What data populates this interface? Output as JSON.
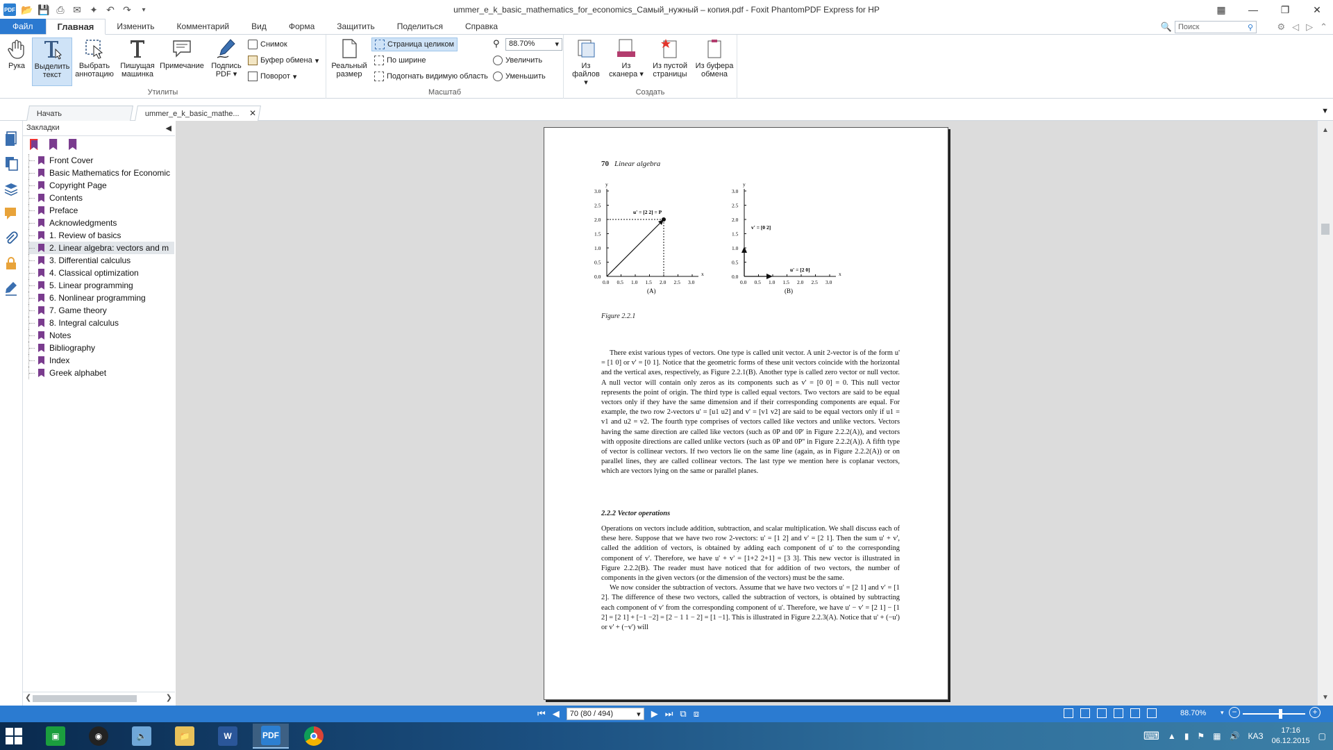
{
  "titlebar": {
    "app_icon_label": "PDF",
    "title": "ummer_e_k_basic_mathematics_for_economics_Самый_нужный – копия.pdf - Foxit PhantomPDF Express for HP"
  },
  "ribbon_tabs": [
    "Файл",
    "Главная",
    "Изменить",
    "Комментарий",
    "Вид",
    "Форма",
    "Защитить",
    "Поделиться",
    "Справка"
  ],
  "search": {
    "placeholder": "Поиск"
  },
  "ribbon": {
    "utilities": {
      "label": "Утилиты",
      "hand": "Рука",
      "select_text_1": "Выделить",
      "select_text_2": "текст",
      "select_annot_1": "Выбрать",
      "select_annot_2": "аннотацию",
      "typewriter_1": "Пишущая",
      "typewriter_2": "машинка",
      "note": "Примечание",
      "sign_1": "Подпись",
      "sign_2": "PDF",
      "snapshot": "Снимок",
      "clipboard": "Буфер обмена",
      "rotate": "Поворот"
    },
    "zoom": {
      "label": "Масштаб",
      "actual_1": "Реальный",
      "actual_2": "размер",
      "fit_page": "Страница целиком",
      "fit_width": "По ширине",
      "fit_visible": "Подогнать видимую область",
      "value": "88.70%",
      "zoom_in": "Увеличить",
      "zoom_out": "Уменьшить"
    },
    "create": {
      "label": "Создать",
      "from_files_1": "Из",
      "from_files_2": "файлов",
      "from_scanner_1": "Из",
      "from_scanner_2": "сканера",
      "from_blank_1": "Из пустой",
      "from_blank_2": "страницы",
      "from_clip_1": "Из буфера",
      "from_clip_2": "обмена"
    }
  },
  "doctabs": {
    "start": "Начать",
    "current": "ummer_e_k_basic_mathe..."
  },
  "bookmarks": {
    "title": "Закладки",
    "items": [
      "Front Cover",
      "Basic Mathematics for Economic",
      "Copyright Page",
      "Contents",
      "Preface",
      "Acknowledgments",
      "1. Review of basics",
      "2. Linear algebra: vectors and m",
      "3. Differential calculus",
      "4. Classical optimization",
      "5. Linear programming",
      "6. Nonlinear programming",
      "7. Game theory",
      "8. Integral calculus",
      "Notes",
      "Bibliography",
      "Index",
      "Greek alphabet"
    ],
    "selected_index": 7
  },
  "page": {
    "number": "70",
    "running_title": "Linear algebra",
    "figure_caption": "Figure 2.2.1",
    "figA": {
      "label": "(A)",
      "annotation": "u' = [2  2] = P",
      "x_ticks": [
        "0.0",
        "0.5",
        "1.0",
        "1.5",
        "2.0",
        "2.5",
        "3.0"
      ],
      "y_ticks": [
        "0.0",
        "0.5",
        "1.0",
        "1.5",
        "2.0",
        "2.5",
        "3.0"
      ],
      "x_axis": "x",
      "y_axis": "y"
    },
    "figB": {
      "label": "(B)",
      "annotation_v": "v' = [0  2]",
      "annotation_u": "u' = [2  0]",
      "x_ticks": [
        "0.0",
        "0.5",
        "1.0",
        "1.5",
        "2.0",
        "2.5",
        "3.0"
      ],
      "y_ticks": [
        "0.0",
        "0.5",
        "1.0",
        "1.5",
        "2.0",
        "2.5",
        "3.0"
      ],
      "x_axis": "x",
      "y_axis": "y"
    },
    "para1": "There exist various types of vectors. One type is called unit vector. A unit 2-vector is of the form u' = [1  0] or v' = [0  1]. Notice that the geometric forms of these unit vectors coincide with the horizontal and the vertical axes, respectively, as Figure 2.2.1(B). Another type is called zero vector or null vector. A null vector will contain only zeros as its components such as v' = [0  0] = 0. This null vector represents the point of origin. The third type is called equal vectors. Two vectors are said to be equal vectors only if they have the same dimension and if their corresponding components are equal. For example, the two row 2-vectors u' = [u1  u2] and v' = [v1  v2] are said to be equal vectors only if u1 = v1 and u2 = v2. The fourth type comprises of vectors called like vectors and unlike vectors. Vectors having the same direction are called like vectors (such as 0P and 0P' in Figure 2.2.2(A)), and vectors with opposite directions are called unlike vectors (such as 0P and 0P'' in Figure 2.2.2(A)). A fifth type of vector is collinear vectors. If two vectors lie on the same line (again, as in Figure 2.2.2(A)) or on parallel lines, they are called collinear vectors. The last type we mention here is coplanar vectors, which are vectors lying on the same or parallel planes.",
    "subheading": "2.2.2  Vector operations",
    "para2": "Operations on vectors include addition, subtraction, and scalar multiplication. We shall discuss each of these here. Suppose that we have two row 2-vectors: u' = [1  2] and v' = [2  1]. Then the sum u' + v', called the addition of vectors, is obtained by adding each component of u' to the corresponding component of v'. Therefore, we have u' + v' = [1+2  2+1] = [3  3]. This new vector is illustrated in Figure 2.2.2(B). The reader must have noticed that for addition of two vectors, the number of components in the given vectors (or the dimension of the vectors) must be the same.",
    "para3": "We now consider the subtraction of vectors. Assume that we have two vectors u' = [2  1] and v' = [1  2]. The difference of these two vectors, called the subtraction of vectors, is obtained by subtracting each component of v' from the corresponding component of u'. Therefore, we have u' − v' = [2  1] − [1  2] = [2  1] + [−1  −2] = [2 − 1  1 − 2] = [1  −1]. This is illustrated in Figure 2.2.3(A). Notice that u' + (−u') or v' + (−v') will"
  },
  "statusbar": {
    "page_field": "70 (80 / 494)",
    "zoom": "88.70%"
  },
  "taskbar": {
    "lang": "КАЗ",
    "time": "17:16",
    "date": "06.12.2015"
  },
  "colors": {
    "accent": "#2b7bd1",
    "bookmark_flag": "#7a3c8e"
  }
}
